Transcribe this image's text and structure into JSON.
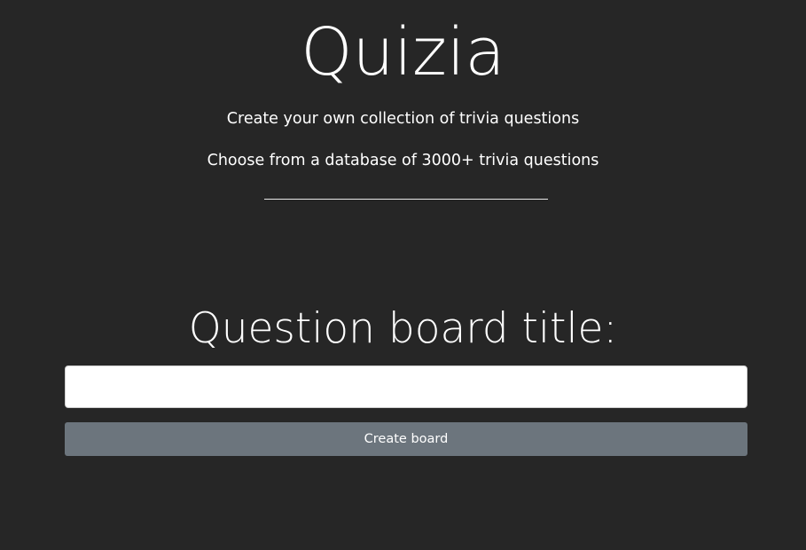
{
  "header": {
    "brand": "Quizia",
    "taglines": [
      "Create your own collection of trivia questions",
      "Choose from a database of 3000+ trivia questions"
    ]
  },
  "form": {
    "title_label": "Question board title:",
    "title_value": "",
    "submit_label": "Create board"
  },
  "colors": {
    "background": "#262626",
    "text": "#ffffff",
    "button": "#6c757d",
    "input_background": "#ffffff"
  }
}
